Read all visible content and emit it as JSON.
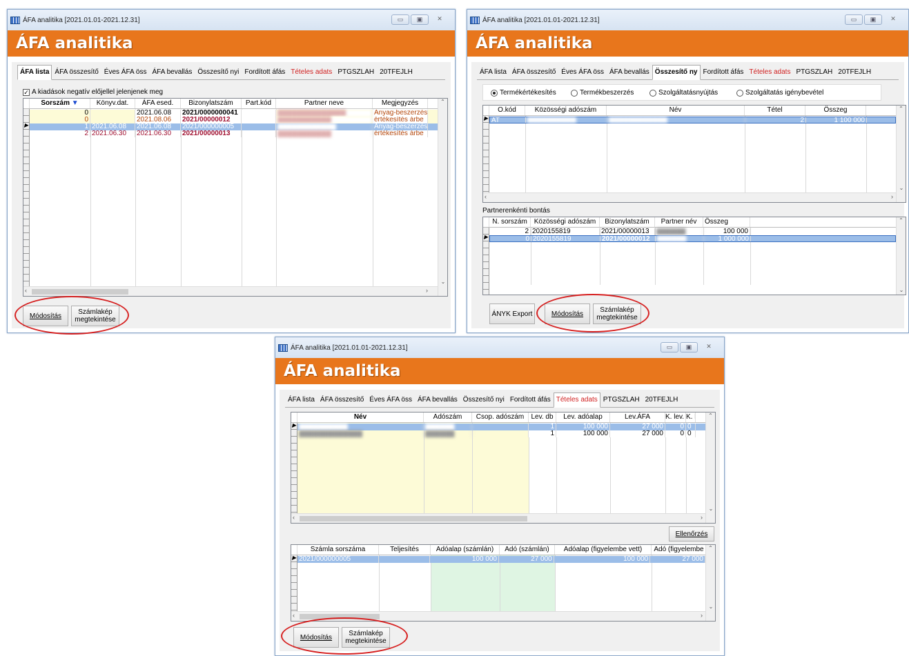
{
  "window_title": "ÁFA analitika [2021.01.01-2021.12.31]",
  "banner": "ÁFA analitika",
  "tabs": [
    "ÁFA lista",
    "ÁFA összesítő",
    "Éves ÁFA öss",
    "ÁFA bevallás",
    "Összesítő nyi",
    "Fordított áfás",
    "Tételes adats",
    "PTGSZLAH",
    "20TFEJLH"
  ],
  "tabs_w2": [
    "ÁFA lista",
    "ÁFA összesítő",
    "Éves ÁFA öss",
    "ÁFA bevallás",
    "Összesítő ny",
    "Fordított áfás",
    "Tételes adats",
    "PTGSZLAH",
    "20TFEJLH"
  ],
  "w1": {
    "checkbox": "A kiadások negatív előjellel jelenjenek meg",
    "cols": [
      "Sorszám",
      "Könyv.dat.",
      "ÁFA esed.",
      "Bizonylatszám",
      "Part.kód",
      "Partner neve",
      "Megjegyzés"
    ],
    "rows": [
      [
        "0",
        "",
        "2021.06.08",
        "2021/0000000041",
        "",
        "",
        "Anyag-beszerzés"
      ],
      [
        "0",
        "",
        "2021.08.06",
        "2021/00000012",
        "",
        "",
        "értékesítés árbe"
      ],
      [
        "1",
        "2021.06.08",
        "2021.06.08",
        "2021/000000005",
        "",
        "",
        "Anyag-beszerzés"
      ],
      [
        "2",
        "2021.06.30",
        "2021.06.30",
        "2021/00000013",
        "",
        "",
        "értékesítés árbe"
      ]
    ]
  },
  "w2": {
    "radios": [
      "Termékértékesítés",
      "Termékbeszerzés",
      "Szolgáltatásnyújtás",
      "Szolgáltatás igénybevétel"
    ],
    "cols": [
      "O.kód",
      "Közösségi adószám",
      "Név",
      "Tétel",
      "Összeg"
    ],
    "row": [
      "AT",
      "",
      "",
      "2",
      "1 100 000"
    ],
    "section": "Partnerenkénti bontás",
    "cols2": [
      "N. sorszám",
      "Közösségi adószám",
      "Bizonylatszám",
      "Partner név",
      "Összeg"
    ],
    "rows2": [
      [
        "2",
        "2020155819",
        "2021/00000013",
        "",
        "100 000"
      ],
      [
        "0",
        "2020155819",
        "2021/00000012",
        "",
        "1 000 000"
      ]
    ],
    "anyk": "ÁNYK Export"
  },
  "w3": {
    "cols": [
      "Név",
      "Adószám",
      "Csop. adószám",
      "Lev. db",
      "Lev. adóalap",
      "Lev.ÁFA",
      "K. lev. db",
      "K. l"
    ],
    "rows": [
      [
        "",
        "",
        "",
        "1",
        "100 000",
        "27 000",
        "0",
        "0"
      ],
      [
        "",
        "",
        "",
        "1",
        "100 000",
        "27 000",
        "0",
        "0"
      ]
    ],
    "check": "Ellenőrzés",
    "cols2": [
      "Számla sorszáma",
      "Teljesítés",
      "Adóalap (számlán)",
      "Adó (számlán)",
      "Adóalap (figyelembe vett)",
      "Adó (figyelembe"
    ],
    "row2": [
      "2021/000000005",
      "",
      "100 000",
      "27 000",
      "100 000",
      "27 000"
    ]
  },
  "buttons": {
    "modify": "Módosítás",
    "invoice1": "Számlakép",
    "invoice2": "megtekintése"
  }
}
